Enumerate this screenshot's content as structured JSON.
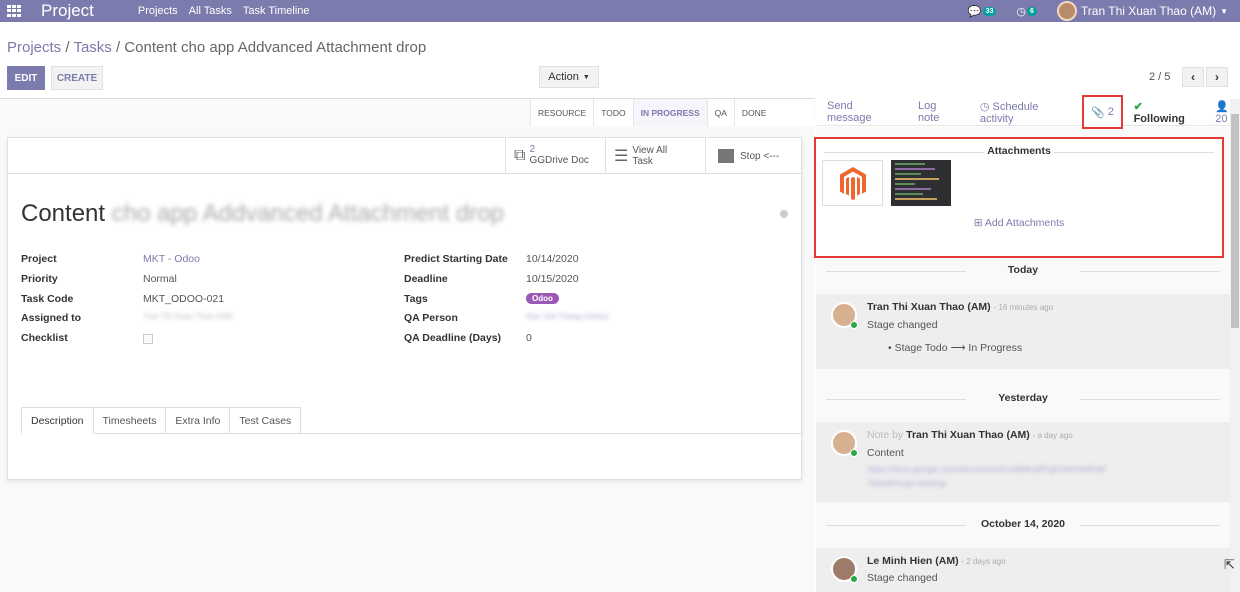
{
  "navbar": {
    "app_name": "Project",
    "menus": [
      "Projects",
      "All Tasks",
      "Task Timeline"
    ],
    "messages_count": "33",
    "activities_count": "6",
    "user_name": "Tran Thi Xuan Thao (AM)",
    "colors": {
      "navbar": "#7c7bad",
      "badge": "#00a09d"
    }
  },
  "breadcrumb": {
    "projects": "Projects",
    "tasks": "Tasks",
    "current": "Content cho app Addvanced Attachment drop"
  },
  "toolbar": {
    "edit_label": "EDIT",
    "create_label": "CREATE",
    "action_label": "Action",
    "pager": "2 / 5"
  },
  "statusbar": {
    "stages": [
      "RESOURCE",
      "TODO",
      "IN PROGRESS",
      "QA",
      "DONE"
    ],
    "active_stage": "IN PROGRESS"
  },
  "smart_buttons": {
    "gdrive_count": "2",
    "gdrive_label": "GGDrive Doc",
    "view_all_1": "View All",
    "view_all_2": "Task",
    "stop_label": "Stop <---"
  },
  "task": {
    "title_prefix": "Content",
    "title_rest": "cho app Addvanced Attachment drop",
    "left_fields": [
      {
        "label": "Project",
        "value": "MKT - Odoo"
      },
      {
        "label": "Priority",
        "value": "Normal"
      },
      {
        "label": "Task Code",
        "value": "MKT_ODOO-021"
      },
      {
        "label": "Assigned to",
        "value": "Tran Thi Xuan Thao (AM)"
      },
      {
        "label": "Checklist",
        "value": ""
      }
    ],
    "right_fields": [
      {
        "label": "Predict Starting Date",
        "value": "10/14/2020"
      },
      {
        "label": "Deadline",
        "value": "10/15/2020"
      },
      {
        "label": "Tags",
        "value": "Odoo"
      },
      {
        "label": "QA Person",
        "value": "Dao Viet Thang (Odoo)"
      },
      {
        "label": "QA Deadline (Days)",
        "value": "0"
      }
    ],
    "tabs": [
      "Description",
      "Timesheets",
      "Extra Info",
      "Test Cases"
    ]
  },
  "chatter": {
    "send_message": "Send message",
    "log_note": "Log note",
    "schedule_activity": "Schedule activity",
    "attachment_count": "2",
    "following": "Following",
    "followers": "20",
    "attachments_title": "Attachments",
    "add_attachments": "Add Attachments",
    "groups": [
      {
        "date": "Today",
        "author": "Tran Thi Xuan Thao (AM)",
        "ago": "- 16 minutes ago",
        "body": "Stage changed",
        "detail": "Stage Todo ⟶ In Progress"
      },
      {
        "date": "Yesterday",
        "note_by": "Note by",
        "author": "Tran Thi Xuan Thao (AM)",
        "ago": "- a day ago",
        "body": "Content",
        "link_1": "https://docs.google.com/document/d/1a8b9cdEFghIJklmNoPqR",
        "link_2": "7tk/edit?usp=sharing"
      },
      {
        "date": "October 14, 2020",
        "author": "Le Minh Hien (AM)",
        "ago": "- 2 days ago",
        "body": "Stage changed"
      }
    ]
  }
}
